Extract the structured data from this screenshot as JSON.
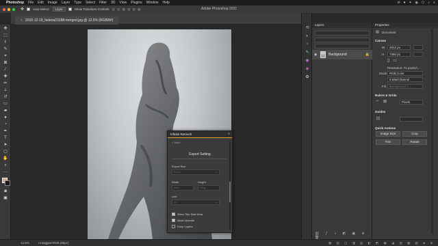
{
  "menubar": {
    "app_name": "Photoshop",
    "items": [
      "File",
      "Edit",
      "Image",
      "Layer",
      "Type",
      "Select",
      "Filter",
      "3D",
      "View",
      "Plugins",
      "Window",
      "Help"
    ],
    "right_icons": [
      "✉",
      "⏺",
      "✦",
      "◉",
      "⬡",
      "⌕",
      "≡"
    ]
  },
  "window": {
    "title": "Adobe Photoshop 2021"
  },
  "options": {
    "auto_select_label": "Auto-Select:",
    "auto_select_value": "Layer",
    "show_transform_label": "Show Transform Controls"
  },
  "document": {
    "tab_label": "2016-12-19_helena23188-merged.jpg @ 12.5% (RGB/8#)"
  },
  "status": {
    "zoom": "12.5%",
    "profile": "Untagged RGB (8bpc)"
  },
  "layers": {
    "header": "Layers",
    "layer_name": "Background"
  },
  "properties": {
    "header": "Properties",
    "document_label": "Document",
    "canvas_label": "Canvas",
    "w_label": "W",
    "w_value": "4912 px",
    "h_label": "H",
    "h_value": "7360 px",
    "resolution": "Resolution: 72 pixels/i...",
    "mode_label": "Mode",
    "mode_value": "RGB Color",
    "bits_value": "8 Bits/Channel",
    "fill_label": "Fill",
    "fill_value": "Background C...",
    "rulers_label": "Rulers & Grids",
    "rulers_unit": "Pixels",
    "guides_label": "Guides",
    "quick_actions_label": "Quick Actions",
    "image_size_button": "Image Size",
    "crop_button": "Crop",
    "trim_button": "Trim",
    "rotate_button": "Rotate"
  },
  "plugin": {
    "title": "Infinite Retouch",
    "back_label": "< Back",
    "section_title": "Export Setting",
    "export_size_label": "Export Size",
    "export_size_value": "Fixed",
    "width_label": "Width",
    "width_value": "Wid...",
    "height_label": "Height",
    "height_value": "Heig...",
    "unit_label": "Unit",
    "unit_value": "px",
    "options": [
      {
        "label": "Show Title Safe Area",
        "checked": true
      },
      {
        "label": "Allow Upscale",
        "checked": true
      },
      {
        "label": "Keep Layers",
        "checked": false
      }
    ]
  },
  "colors": {
    "foreground": "#d8a898",
    "background": "#1a1a1a",
    "accent": "#f0a030"
  }
}
